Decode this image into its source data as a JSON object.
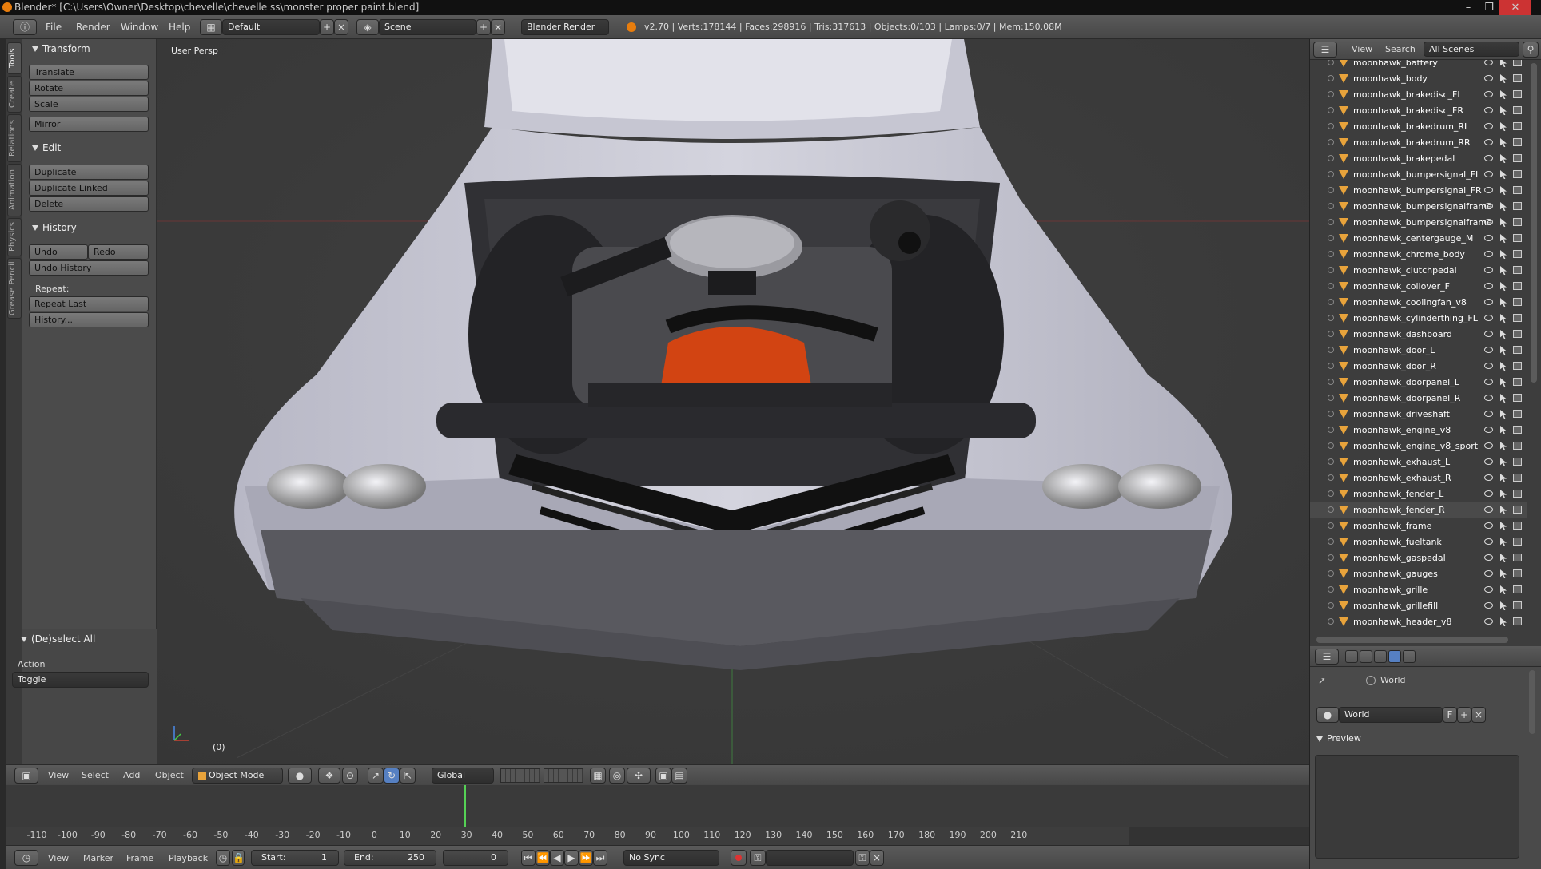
{
  "titlebar": {
    "title": "Blender* [C:\\Users\\Owner\\Desktop\\chevelle\\chevelle ss\\monster proper paint.blend]"
  },
  "infobar": {
    "menus": [
      "File",
      "Render",
      "Window",
      "Help"
    ],
    "layout": "Default",
    "scene": "Scene",
    "engine": "Blender Render",
    "stats": "v2.70 | Verts:178144 | Faces:298916 | Tris:317613 | Objects:0/103 | Lamps:0/7 | Mem:150.08M"
  },
  "lefttabs": [
    "Tools",
    "Create",
    "Relations",
    "Animation",
    "Physics",
    "Grease Pencil"
  ],
  "toolshelf": {
    "transform": {
      "title": "Transform",
      "buttons": [
        "Translate",
        "Rotate",
        "Scale",
        "Mirror"
      ]
    },
    "edit": {
      "title": "Edit",
      "buttons": [
        "Duplicate",
        "Duplicate Linked",
        "Delete"
      ]
    },
    "history": {
      "title": "History",
      "undo": "Undo",
      "redo": "Redo",
      "undo_history": "Undo History",
      "repeat_label": "Repeat:",
      "repeat_last": "Repeat Last",
      "history_btn": "History..."
    },
    "operator": {
      "title": "(De)select All",
      "action_label": "Action",
      "action_value": "Toggle"
    }
  },
  "viewport": {
    "view_label": "User Persp",
    "frame_label": "(0)"
  },
  "outliner": {
    "view": "View",
    "search": "Search",
    "scenes": "All Scenes",
    "items": [
      "moonhawk_battery",
      "moonhawk_body",
      "moonhawk_brakedisc_FL",
      "moonhawk_brakedisc_FR",
      "moonhawk_brakedrum_RL",
      "moonhawk_brakedrum_RR",
      "moonhawk_brakepedal",
      "moonhawk_bumpersignal_FL",
      "moonhawk_bumpersignal_FR",
      "moonhawk_bumpersignalframe",
      "moonhawk_bumpersignalframe",
      "moonhawk_centergauge_M",
      "moonhawk_chrome_body",
      "moonhawk_clutchpedal",
      "moonhawk_coilover_F",
      "moonhawk_coolingfan_v8",
      "moonhawk_cylinderthing_FL",
      "moonhawk_dashboard",
      "moonhawk_door_L",
      "moonhawk_door_R",
      "moonhawk_doorpanel_L",
      "moonhawk_doorpanel_R",
      "moonhawk_driveshaft",
      "moonhawk_engine_v8",
      "moonhawk_engine_v8_sport",
      "moonhawk_exhaust_L",
      "moonhawk_exhaust_R",
      "moonhawk_fender_L",
      "moonhawk_fender_R",
      "moonhawk_frame",
      "moonhawk_fueltank",
      "moonhawk_gaspedal",
      "moonhawk_gauges",
      "moonhawk_grille",
      "moonhawk_grillefill",
      "moonhawk_header_v8"
    ]
  },
  "properties": {
    "breadcrumb": "World",
    "world_field": "World",
    "fake_user": "F",
    "preview_title": "Preview"
  },
  "viewheader": {
    "menus": [
      "View",
      "Select",
      "Add",
      "Object"
    ],
    "mode": "Object Mode",
    "orientation": "Global"
  },
  "timeline": {
    "ticks": [
      "-110",
      "-100",
      "-90",
      "-80",
      "-70",
      "-60",
      "-50",
      "-40",
      "-30",
      "-20",
      "-10",
      "0",
      "10",
      "20",
      "30",
      "40",
      "50",
      "60",
      "70",
      "80",
      "90",
      "100",
      "110",
      "120",
      "130",
      "140",
      "150",
      "160",
      "170",
      "180",
      "190",
      "200",
      "210"
    ],
    "menus": [
      "View",
      "Marker",
      "Frame",
      "Playback"
    ],
    "start": "Start:",
    "start_val": "1",
    "end": "End:",
    "end_val": "250",
    "current": "0",
    "sync": "No Sync"
  }
}
